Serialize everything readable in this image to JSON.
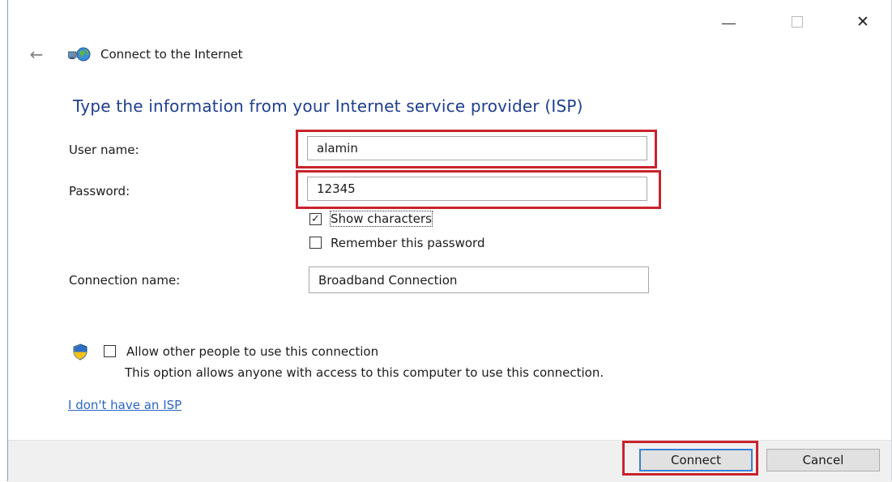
{
  "window": {
    "title": "Connect to the Internet",
    "controls": {
      "minimize_icon": "minimize-icon",
      "maximize_icon": "maximize-icon",
      "close_glyph": "✕"
    },
    "back_glyph": "←"
  },
  "heading": "Type the information from your Internet service provider (ISP)",
  "fields": {
    "username": {
      "label": "User name:",
      "value": "alamin"
    },
    "password": {
      "label": "Password:",
      "value": "12345"
    },
    "connection_name": {
      "label": "Connection name:",
      "value": "Broadband Connection"
    }
  },
  "options": {
    "show_characters": {
      "label": "Show characters",
      "checked": true,
      "mark": "✓"
    },
    "remember_password": {
      "label": "Remember this password",
      "checked": false
    },
    "allow_others": {
      "label": "Allow other people to use this connection",
      "checked": false,
      "description": "This option allows anyone with access to this computer to use this connection."
    }
  },
  "links": {
    "no_isp": "I don't have an ISP"
  },
  "buttons": {
    "connect": "Connect",
    "cancel": "Cancel"
  },
  "colors": {
    "highlight": "#c8232c",
    "heading": "#1e3f8f",
    "link": "#2a66c4",
    "default_button_border": "#3c7fd1"
  }
}
